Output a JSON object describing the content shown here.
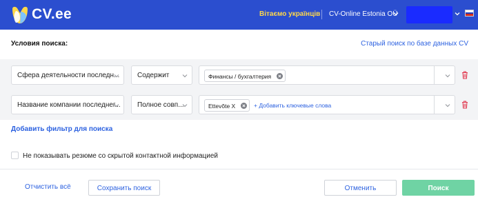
{
  "header": {
    "logo_text": "CV.ee",
    "ukraine_link": "Вітаємо українців",
    "company_name": "CV-Online Estonia OÜ",
    "language_flag": "ru-flag"
  },
  "search": {
    "title": "Условия поиска:",
    "old_search_link": "Старый поиск по базе данных CV",
    "filters": [
      {
        "field": "Сфера деятельности последн...",
        "operator": "Содержит",
        "chips": [
          "Финансы / бухгалтерия"
        ],
        "add_keywords": ""
      },
      {
        "field": "Название компании последнег...",
        "operator": "Полное совп...",
        "chips": [
          "Ettevõte X"
        ],
        "add_keywords": "+ Добавить ключевые слова"
      }
    ],
    "add_filter": "Добавить фильтр для поиска",
    "hide_hidden_label": "Не показывать резюме со скрытой контактной информацией"
  },
  "footer": {
    "clear_all": "Отчистить всё",
    "save_search": "Сохранить поиск",
    "cancel": "Отменить",
    "search": "Поиск"
  },
  "colors": {
    "header_bg": "#2b4ecf",
    "link": "#2d62e0",
    "primary_button": "#6fd3a4",
    "delete_icon": "#e0344b",
    "highlight_yellow": "#ffd84a"
  }
}
